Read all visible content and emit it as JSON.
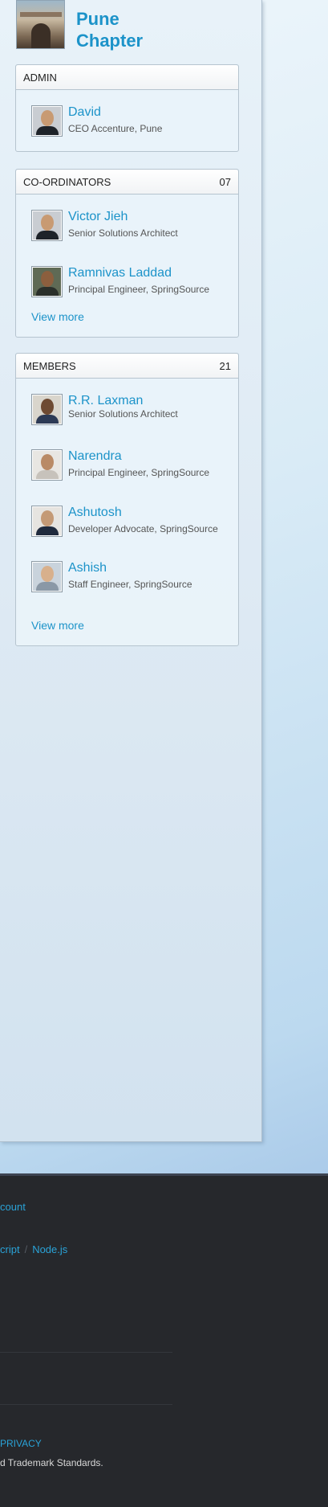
{
  "chapter": {
    "title_line1": "Pune",
    "title_line2": "Chapter"
  },
  "admin": {
    "header": "ADMIN",
    "people": [
      {
        "name": "David",
        "title": "CEO Accenture, Pune"
      }
    ]
  },
  "coordinators": {
    "header": "CO-ORDINATORS",
    "count": "07",
    "people": [
      {
        "name": "Victor Jieh",
        "title": "Senior Solutions Architect"
      },
      {
        "name": "Ramnivas Laddad",
        "title": "Principal Engineer, SpringSource"
      }
    ],
    "view_more": "View more"
  },
  "members": {
    "header": "MEMBERS",
    "count": "21",
    "people": [
      {
        "name": "R.R. Laxman",
        "title": "Senior Solutions Architect"
      },
      {
        "name": "Narendra",
        "title": "Principal Engineer, SpringSource"
      },
      {
        "name": "Ashutosh",
        "title": "Developer Advocate, SpringSource"
      },
      {
        "name": "Ashish",
        "title": "Staff Engineer, SpringSource"
      }
    ],
    "view_more": "View more"
  },
  "footer": {
    "account_link": "count",
    "tech_links": [
      "cript",
      "Node.js"
    ],
    "separator": "/",
    "privacy_link": "PRIVACY",
    "copyright": "d Trademark Standards."
  },
  "colors": {
    "accent": "#1c93c9",
    "footer_bg": "#26282c"
  }
}
